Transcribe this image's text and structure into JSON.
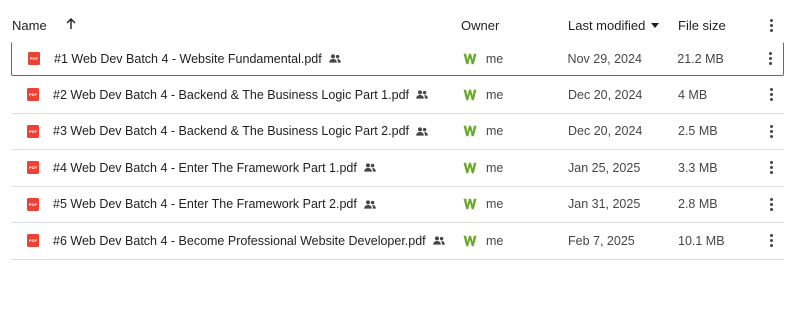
{
  "header": {
    "name_label": "Name",
    "owner_label": "Owner",
    "modified_label": "Last modified",
    "size_label": "File size"
  },
  "icon_colors": {
    "pdf": "#ea4335",
    "owner_logo": "#6aa82a",
    "selection_border": "#3b6fc7"
  },
  "files": [
    {
      "name": "#1 Web Dev Batch 4 - Website Fundamental.pdf",
      "owner": "me",
      "modified": "Nov 29, 2024",
      "size": "21.2 MB",
      "shared": true,
      "selected": true
    },
    {
      "name": "#2 Web Dev Batch 4 - Backend & The Business Logic Part 1.pdf",
      "owner": "me",
      "modified": "Dec 20, 2024",
      "size": "4 MB",
      "shared": true,
      "selected": false
    },
    {
      "name": "#3 Web Dev Batch 4 - Backend & The Business Logic Part 2.pdf",
      "owner": "me",
      "modified": "Dec 20, 2024",
      "size": "2.5 MB",
      "shared": true,
      "selected": false
    },
    {
      "name": "#4 Web Dev Batch 4 - Enter The Framework Part 1.pdf",
      "owner": "me",
      "modified": "Jan 25, 2025",
      "size": "3.3 MB",
      "shared": true,
      "selected": false
    },
    {
      "name": "#5 Web Dev Batch 4 - Enter The Framework Part 2.pdf",
      "owner": "me",
      "modified": "Jan 31, 2025",
      "size": "2.8 MB",
      "shared": true,
      "selected": false
    },
    {
      "name": "#6 Web Dev Batch 4 - Become Professional Website Developer.pdf",
      "owner": "me",
      "modified": "Feb 7, 2025",
      "size": "10.1 MB",
      "shared": true,
      "selected": false
    }
  ],
  "pdf_badge": "PDF"
}
